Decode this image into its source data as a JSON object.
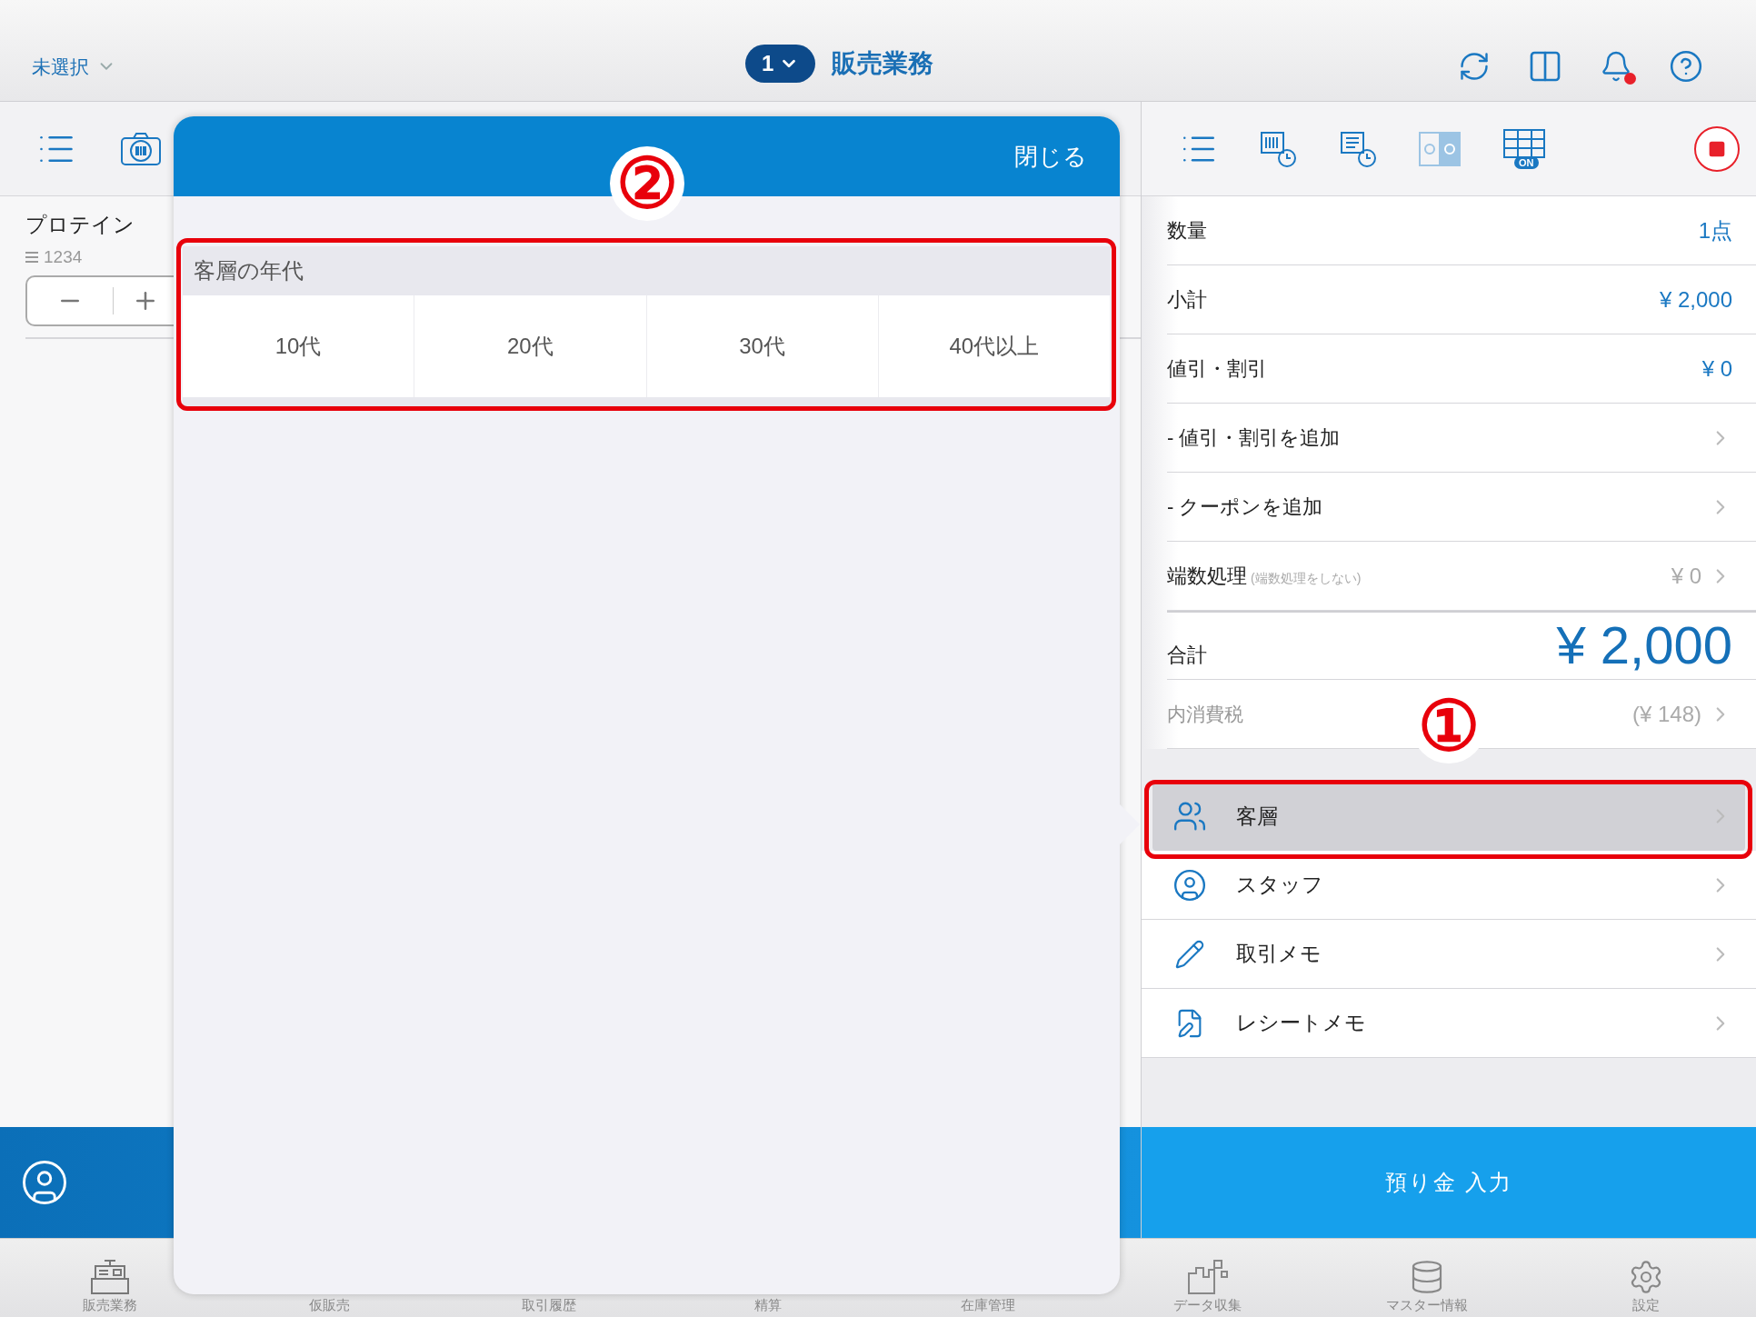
{
  "top_bar": {
    "store_selector": "未選択",
    "register_number": "1",
    "title": "販売業務",
    "notification_badge": true,
    "grid_toggle_label": "ON"
  },
  "cart": {
    "items": [
      {
        "name": "プロテイン",
        "code": "1234"
      }
    ]
  },
  "modal": {
    "close": "閉じる",
    "sections": [
      {
        "title": "客層の年代",
        "options": [
          {
            "label": "10代",
            "selected": false
          },
          {
            "label": "20代",
            "selected": false
          },
          {
            "label": "30代",
            "selected": false
          },
          {
            "label": "40代以上",
            "selected": false
          }
        ]
      }
    ]
  },
  "summary": {
    "rows": [
      {
        "kind": "value",
        "label": "数量",
        "value": "1点"
      },
      {
        "kind": "value",
        "label": "小計",
        "value": "¥ 2,000"
      },
      {
        "kind": "value",
        "label": "値引・割引",
        "value": "¥ 0"
      },
      {
        "kind": "link",
        "label": "- 値引・割引を追加"
      },
      {
        "kind": "link",
        "label": "- クーポンを追加"
      },
      {
        "kind": "link",
        "label": "端数処理",
        "note": "(端数処理をしない)",
        "value": "¥ 0"
      }
    ],
    "total": {
      "label": "合計",
      "value": "¥ 2,000"
    },
    "tax": {
      "label": "内消費税",
      "value": "(¥ 148)"
    }
  },
  "menu": [
    {
      "kind": "customers",
      "label": "客層",
      "selected": true
    },
    {
      "kind": "staff",
      "label": "スタッフ",
      "selected": false
    },
    {
      "kind": "memo",
      "label": "取引メモ",
      "selected": false
    },
    {
      "kind": "receipt",
      "label": "レシートメモ",
      "selected": false
    }
  ],
  "pay_button": "預り金 入力",
  "tab_bar": [
    {
      "kind": "register",
      "label": "販売業務"
    },
    {
      "label": "仮販売"
    },
    {
      "label": "取引履歴"
    },
    {
      "label": "精算"
    },
    {
      "label": "在庫管理"
    },
    {
      "kind": "data",
      "label": "データ収集"
    },
    {
      "kind": "master",
      "label": "マスター情報"
    },
    {
      "kind": "settings",
      "label": "設定"
    }
  ],
  "annotations": [
    {
      "label": "②"
    },
    {
      "label": "①"
    }
  ]
}
